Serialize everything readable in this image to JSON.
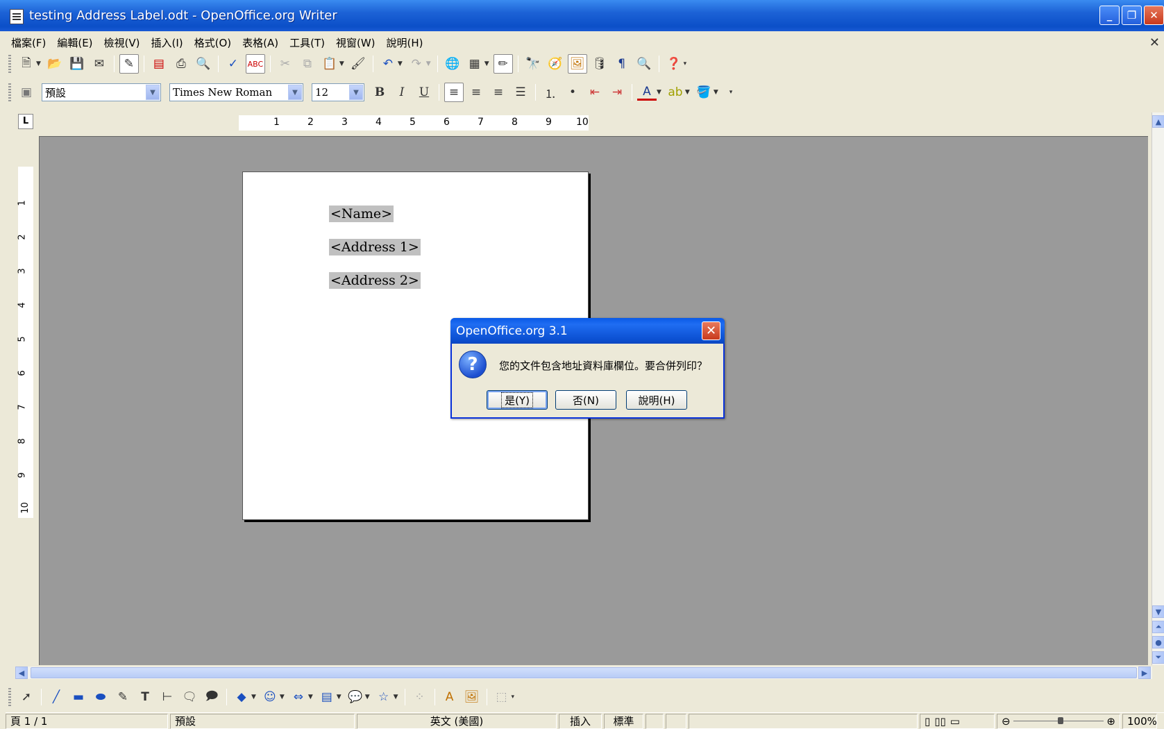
{
  "window": {
    "title": "testing Address Label.odt - OpenOffice.org Writer",
    "controls": {
      "minimize": "_",
      "restore": "❐",
      "close": "✕"
    }
  },
  "menu": {
    "items": [
      "檔案(F)",
      "編輯(E)",
      "檢視(V)",
      "插入(I)",
      "格式(O)",
      "表格(A)",
      "工具(T)",
      "視窗(W)",
      "說明(H)"
    ],
    "close_doc": "✕"
  },
  "format_bar": {
    "style": "預設",
    "font": "Times New Roman",
    "size": "12",
    "bold": "B",
    "italic": "I",
    "underline": "U"
  },
  "ruler": {
    "corner": "L",
    "h_numbers": [
      "1",
      "2",
      "3",
      "4",
      "5",
      "6",
      "7",
      "8",
      "9",
      "10"
    ],
    "v_numbers": [
      "1",
      "2",
      "3",
      "4",
      "5",
      "6",
      "7",
      "8",
      "9",
      "10"
    ]
  },
  "document": {
    "fields": [
      "<Name>",
      "<Address 1>",
      "<Address 2>"
    ]
  },
  "dialog": {
    "title": "OpenOffice.org 3.1",
    "icon": "?",
    "message": "您的文件包含地址資料庫欄位。要合併列印？",
    "yes": "是(Y)",
    "no": "否(N)",
    "help": "說明(H)",
    "close": "✕"
  },
  "statusbar": {
    "page": "頁 1 / 1",
    "style": "預設",
    "language": "英文 (美國)",
    "insert_mode": "插入",
    "selection_mode": "標準",
    "zoom": "100%"
  },
  "colors": {
    "title_blue": "#0b4fc8",
    "workspace_gray": "#9a9a9a",
    "chrome": "#ece9d8",
    "field_shading": "#c0c0c0"
  }
}
